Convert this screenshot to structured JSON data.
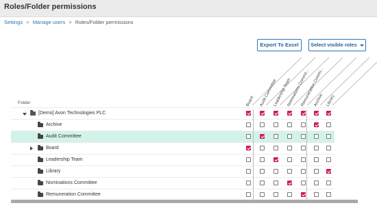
{
  "page": {
    "title": "Roles/Folder permissions"
  },
  "breadcrumb": {
    "items": [
      "Settings",
      "Manage users",
      "Roles/Folder permissions"
    ],
    "separator": ">"
  },
  "toolbar": {
    "export_label": "Export To Excel",
    "select_roles_label": "Select visible roles"
  },
  "table": {
    "folder_header": "Folder",
    "roles": [
      "Board",
      "Audit Committee",
      "Leadership Team",
      "Nominations Commit...",
      "Remuneration Commi...",
      "Archive",
      "Library"
    ],
    "rows": [
      {
        "label": "[Demo] Avon Technologies PLC",
        "level": 0,
        "expander": "expanded",
        "selected": false,
        "checks": [
          true,
          true,
          true,
          true,
          true,
          true,
          true
        ]
      },
      {
        "label": "Archive",
        "level": 1,
        "expander": "none",
        "selected": false,
        "checks": [
          false,
          false,
          false,
          false,
          false,
          true,
          false
        ]
      },
      {
        "label": "Audit Committee",
        "level": 1,
        "expander": "none",
        "selected": true,
        "checks": [
          false,
          true,
          false,
          false,
          false,
          false,
          false
        ]
      },
      {
        "label": "Board",
        "level": 1,
        "expander": "collapsed",
        "selected": false,
        "checks": [
          true,
          false,
          false,
          false,
          false,
          false,
          false
        ]
      },
      {
        "label": "Leadership Team",
        "level": 1,
        "expander": "none",
        "selected": false,
        "checks": [
          false,
          false,
          true,
          false,
          false,
          false,
          false
        ]
      },
      {
        "label": "Library",
        "level": 1,
        "expander": "none",
        "selected": false,
        "checks": [
          false,
          false,
          false,
          false,
          false,
          false,
          true
        ]
      },
      {
        "label": "Nominations Committee",
        "level": 1,
        "expander": "none",
        "selected": false,
        "checks": [
          false,
          false,
          false,
          true,
          false,
          false,
          false
        ]
      },
      {
        "label": "Remuneration Committee",
        "level": 1,
        "expander": "none",
        "selected": false,
        "checks": [
          false,
          false,
          false,
          false,
          true,
          false,
          false
        ]
      }
    ]
  },
  "colors": {
    "checked": "#d81b60",
    "selected_row": "#d3f3ea",
    "link": "#2a74b5"
  }
}
